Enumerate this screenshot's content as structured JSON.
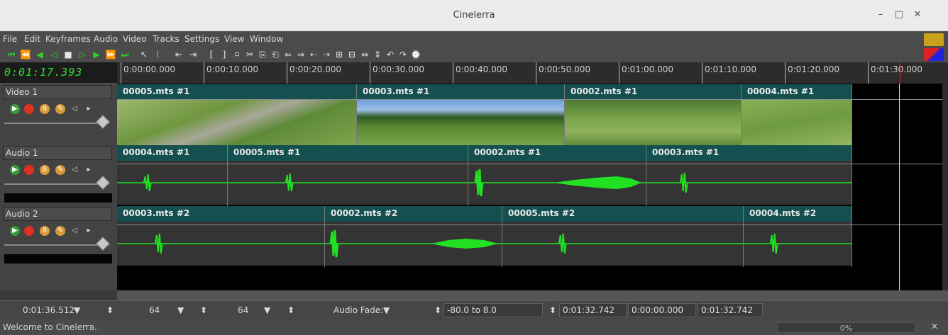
{
  "window": {
    "title": "Cinelerra"
  },
  "menu": [
    "File",
    "Edit",
    "Keyframes",
    "Audio",
    "Video",
    "Tracks",
    "Settings",
    "View",
    "Window"
  ],
  "clock": "0:01:17.393",
  "ruler_labels": [
    "0:00:00.000",
    "0:00:10.000",
    "0:00:20.000",
    "0:00:30.000",
    "0:00:40.000",
    "0:00:50.000",
    "0:01:00.000",
    "0:01:10.000",
    "0:01:20.000",
    "0:01:30.000"
  ],
  "tracks": [
    {
      "name": "Video 1",
      "clips": [
        "00005.mts #1",
        "00003.mts #1",
        "00002.mts #1",
        "00004.mts #1"
      ]
    },
    {
      "name": "Audio 1",
      "clips": [
        "00004.mts #1",
        "00005.mts #1",
        "00002.mts #1",
        "00003.mts #1"
      ]
    },
    {
      "name": "Audio 2",
      "clips": [
        "00003.mts #2",
        "00002.mts #2",
        "00005.mts #2",
        "00004.mts #2"
      ]
    }
  ],
  "bottom": {
    "duration": "0:01:36.512",
    "zoom1": "64",
    "zoom2": "64",
    "fade_label": "Audio Fade:",
    "range": "-80.0 to 8.0",
    "sel_start": "0:01:32.742",
    "sel_len": "0:00:00.000",
    "sel_end": "0:01:32.742"
  },
  "status": {
    "message": "Welcome to Cinelerra.",
    "progress": "0%"
  },
  "colors": {
    "waveform": "#22e022",
    "clip_header": "#145050",
    "clock": "#29e129"
  }
}
